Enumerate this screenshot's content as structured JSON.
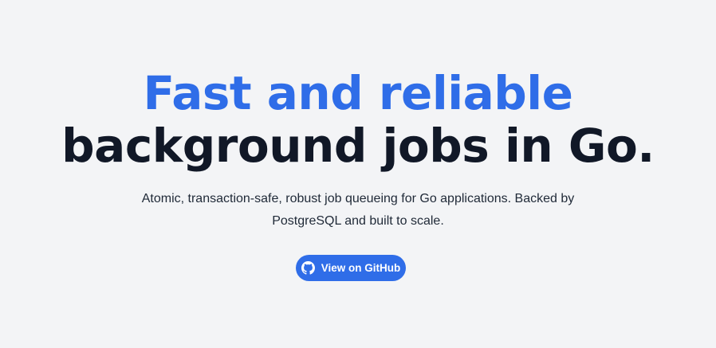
{
  "hero": {
    "headline_accent": "Fast and reliable",
    "headline_main": "background jobs in Go.",
    "subtitle": "Atomic, transaction-safe, robust job queueing for Go applications. Backed by PostgreSQL and built to scale.",
    "cta": {
      "label": "View on GitHub",
      "icon": "github-icon"
    }
  },
  "colors": {
    "background": "#f3f4f6",
    "accent": "#2f6de8",
    "heading": "#111827",
    "body_text": "#1f2937",
    "button_text": "#ffffff"
  }
}
